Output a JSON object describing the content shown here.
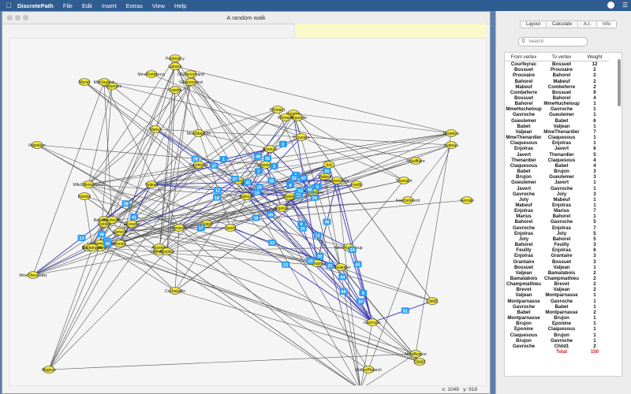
{
  "menubar": {
    "app": "DiscretePath",
    "items": [
      "File",
      "Edit",
      "Insert",
      "Extras",
      "View",
      "Help"
    ]
  },
  "window": {
    "title": "A random walk",
    "coords": {
      "x_label": "x:",
      "x": "1049",
      "y_label": "y:",
      "y": "918"
    }
  },
  "panel": {
    "tabs": [
      "Layout",
      "Calculate",
      "A.I.",
      "Info"
    ],
    "active_tab": "Info",
    "search_placeholder": "Search",
    "columns": [
      "From vertex",
      "To vertex",
      "Weight"
    ],
    "rows": [
      [
        "Courfeyrac",
        "Bossuet",
        "12"
      ],
      [
        "Bossuet",
        "Prouvaire",
        "2"
      ],
      [
        "Prouvaire",
        "Bahorel",
        "2"
      ],
      [
        "Bahorel",
        "Mabeuf",
        "2"
      ],
      [
        "Mabeuf",
        "Combeferre",
        "2"
      ],
      [
        "Combeferre",
        "Bossuet",
        "9"
      ],
      [
        "Bossuet",
        "Bahorel",
        "4"
      ],
      [
        "Bahorel",
        "MmeHucheloup",
        "1"
      ],
      [
        "MmeHucheloup",
        "Gavroche",
        "1"
      ],
      [
        "Gavroche",
        "Gueulemer",
        "1"
      ],
      [
        "Gueulemer",
        "Babet",
        "6"
      ],
      [
        "Babet",
        "Valjean",
        "1"
      ],
      [
        "Valjean",
        "MmeThenardier",
        "7"
      ],
      [
        "MmeThenardier",
        "Claquesous",
        "1"
      ],
      [
        "Claquesous",
        "Enjolras",
        "1"
      ],
      [
        "Enjolras",
        "Javert",
        "6"
      ],
      [
        "Javert",
        "Thenardier",
        "5"
      ],
      [
        "Thenardier",
        "Claquesous",
        "4"
      ],
      [
        "Claquesous",
        "Babet",
        "4"
      ],
      [
        "Babet",
        "Brujon",
        "3"
      ],
      [
        "Brujon",
        "Gueulemer",
        "3"
      ],
      [
        "Gueulemer",
        "Javert",
        "1"
      ],
      [
        "Javert",
        "Gavroche",
        "1"
      ],
      [
        "Gavroche",
        "Joly",
        "3"
      ],
      [
        "Joly",
        "Mabeuf",
        "1"
      ],
      [
        "Mabeuf",
        "Enjolras",
        "1"
      ],
      [
        "Enjolras",
        "Marius",
        "7"
      ],
      [
        "Marius",
        "Bahorel",
        "1"
      ],
      [
        "Bahorel",
        "Gavroche",
        "5"
      ],
      [
        "Gavroche",
        "Enjolras",
        "7"
      ],
      [
        "Enjolras",
        "Joly",
        "5"
      ],
      [
        "Joly",
        "Bahorel",
        "5"
      ],
      [
        "Bahorel",
        "Feuilly",
        "3"
      ],
      [
        "Feuilly",
        "Enjolras",
        "6"
      ],
      [
        "Enjolras",
        "Grantaire",
        "3"
      ],
      [
        "Grantaire",
        "Bossuet",
        "3"
      ],
      [
        "Bossuet",
        "Valjean",
        "1"
      ],
      [
        "Valjean",
        "Bamatabois",
        "2"
      ],
      [
        "Bamatabois",
        "Champmathieu",
        "2"
      ],
      [
        "Champmathieu",
        "Brevet",
        "2"
      ],
      [
        "Brevet",
        "Valjean",
        "2"
      ],
      [
        "Valjean",
        "Montparnasse",
        "1"
      ],
      [
        "Montparnasse",
        "Gavroche",
        "1"
      ],
      [
        "Gavroche",
        "Babet",
        "1"
      ],
      [
        "Babet",
        "Montparnasse",
        "2"
      ],
      [
        "Montparnasse",
        "Brujon",
        "1"
      ],
      [
        "Brujon",
        "Eponine",
        "1"
      ],
      [
        "Eponine",
        "Claquesous",
        "1"
      ],
      [
        "Claquesous",
        "Brujon",
        "1"
      ],
      [
        "Brujon",
        "Gavroche",
        "1"
      ],
      [
        "Gavroche",
        "Child1",
        "2"
      ]
    ],
    "total_label": "Total",
    "total_value": "150"
  },
  "graph": {
    "vertex_color": "#f0e83a",
    "edge_color": "#555555",
    "path_color": "#3a3ab8",
    "badge_color": "#2a9df4",
    "vertices": [
      {
        "id": "Courfeyrac",
        "label": "Courfeyrac"
      },
      {
        "id": "Bossuet",
        "label": "Bossuet"
      },
      {
        "id": "Prouvaire",
        "label": "Prouvaire"
      },
      {
        "id": "Bahorel",
        "label": "Bahorel"
      },
      {
        "id": "Mabeuf",
        "label": "Mabeuf"
      },
      {
        "id": "Combeferre",
        "label": "Combeferre"
      },
      {
        "id": "MmeHucheloup",
        "label": "MmeHucheloup"
      },
      {
        "id": "Gavroche",
        "label": "Gavroche"
      },
      {
        "id": "Gueulemer",
        "label": "Gueulemer"
      },
      {
        "id": "Babet",
        "label": "Babet"
      },
      {
        "id": "Valjean",
        "label": "Valjean"
      },
      {
        "id": "MmeThenardier",
        "label": "MmeThenardier"
      },
      {
        "id": "Claquesous",
        "label": "Claquesous"
      },
      {
        "id": "Enjolras",
        "label": "Enjolras"
      },
      {
        "id": "Javert",
        "label": "Javert"
      },
      {
        "id": "Thenardier",
        "label": "Thenardier"
      },
      {
        "id": "Brujon",
        "label": "Brujon"
      },
      {
        "id": "Joly",
        "label": "Joly"
      },
      {
        "id": "Marius",
        "label": "Marius"
      },
      {
        "id": "Feuilly",
        "label": "Feuilly"
      },
      {
        "id": "Grantaire",
        "label": "Grantaire"
      },
      {
        "id": "Bamatabois",
        "label": "Bamatabois"
      },
      {
        "id": "Champmathieu",
        "label": "Champmathieu"
      },
      {
        "id": "Brevet",
        "label": "Brevet"
      },
      {
        "id": "Montparnasse",
        "label": "Montparnasse"
      },
      {
        "id": "Eponine",
        "label": "Eponine"
      },
      {
        "id": "Child1",
        "label": "Child1"
      },
      {
        "id": "Child2",
        "label": "Child2"
      },
      {
        "id": "Mother",
        "label": "MotherPlutarch"
      },
      {
        "id": "Jondrette",
        "label": "Jondrette"
      },
      {
        "id": "Magnon",
        "label": "Magnon"
      },
      {
        "id": "Napoleon",
        "label": "Napoleon"
      },
      {
        "id": "MlleGillenormand",
        "label": "MlleGillenormand"
      },
      {
        "id": "Fantine",
        "label": "Fantine"
      },
      {
        "id": "Myriel",
        "label": "Myriel"
      },
      {
        "id": "Cosette",
        "label": "Cosette"
      },
      {
        "id": "Gillenormand",
        "label": "Gillenormand"
      },
      {
        "id": "Pontmercy",
        "label": "Pontmercy"
      },
      {
        "id": "Labarre",
        "label": "Labarre"
      },
      {
        "id": "Marguerite",
        "label": "Marguerite"
      },
      {
        "id": "Toussaint",
        "label": "Toussaint"
      },
      {
        "id": "Scaufflaire",
        "label": "Scaufflaire"
      },
      {
        "id": "Fauchelevent",
        "label": "Fauchelevent"
      },
      {
        "id": "Perpetue",
        "label": "Perpetue"
      },
      {
        "id": "Isabeau",
        "label": "Isabeau"
      },
      {
        "id": "Gervais",
        "label": "Gervais"
      },
      {
        "id": "Tholomyes",
        "label": "Tholomyes"
      },
      {
        "id": "Listolier",
        "label": "Listolier"
      },
      {
        "id": "Fameuil",
        "label": "Fameuil"
      },
      {
        "id": "Blacheville",
        "label": "Blacheville"
      },
      {
        "id": "Favourite",
        "label": "Favourite"
      },
      {
        "id": "Dahlia",
        "label": "Dahlia"
      },
      {
        "id": "Zephine",
        "label": "Zephine"
      },
      {
        "id": "MmePontmercy",
        "label": "MmePontmercy"
      },
      {
        "id": "MlleVaubois",
        "label": "MlleVaubois"
      },
      {
        "id": "LtGillenormand",
        "label": "LtGillenormand"
      },
      {
        "id": "MmeMagloire",
        "label": "MmeMagloire"
      },
      {
        "id": "MmeBurgon",
        "label": "MmeBurgon"
      },
      {
        "id": "Cochepaille",
        "label": "Cochepaille"
      },
      {
        "id": "Chenildieu",
        "label": "Chenildieu"
      },
      {
        "id": "Judge",
        "label": "Judge"
      },
      {
        "id": "Woman1",
        "label": "Woman1"
      },
      {
        "id": "Woman2",
        "label": "Woman2"
      },
      {
        "id": "Boulatruelle",
        "label": "Boulatruelle"
      },
      {
        "id": "Anzelma",
        "label": "Anzelma"
      },
      {
        "id": "Simplice",
        "label": "Simplice"
      }
    ],
    "path_edges": [
      [
        "Courfeyrac",
        "Bossuet",
        "1"
      ],
      [
        "Bossuet",
        "Prouvaire",
        "2"
      ],
      [
        "Prouvaire",
        "Bahorel",
        "3"
      ],
      [
        "Bahorel",
        "Mabeuf",
        "4"
      ],
      [
        "Mabeuf",
        "Combeferre",
        "5"
      ],
      [
        "Combeferre",
        "Bossuet",
        "6"
      ],
      [
        "Bossuet",
        "Bahorel",
        "7"
      ],
      [
        "Bahorel",
        "MmeHucheloup",
        "8"
      ],
      [
        "MmeHucheloup",
        "Gavroche",
        "9"
      ],
      [
        "Gavroche",
        "Gueulemer",
        "10"
      ],
      [
        "Gueulemer",
        "Babet",
        "11"
      ],
      [
        "Babet",
        "Valjean",
        "12"
      ],
      [
        "Valjean",
        "MmeThenardier",
        "13"
      ],
      [
        "MmeThenardier",
        "Claquesous",
        "14"
      ],
      [
        "Claquesous",
        "Enjolras",
        "15"
      ],
      [
        "Enjolras",
        "Javert",
        "16"
      ],
      [
        "Javert",
        "Thenardier",
        "17"
      ],
      [
        "Thenardier",
        "Claquesous",
        "18"
      ],
      [
        "Claquesous",
        "Babet",
        "19"
      ],
      [
        "Babet",
        "Brujon",
        "20"
      ],
      [
        "Brujon",
        "Gueulemer",
        "21"
      ],
      [
        "Gueulemer",
        "Javert",
        "22"
      ],
      [
        "Javert",
        "Gavroche",
        "23"
      ],
      [
        "Gavroche",
        "Joly",
        "24"
      ],
      [
        "Joly",
        "Mabeuf",
        "25"
      ],
      [
        "Mabeuf",
        "Enjolras",
        "26"
      ],
      [
        "Enjolras",
        "Marius",
        "27"
      ],
      [
        "Marius",
        "Bahorel",
        "28"
      ],
      [
        "Bahorel",
        "Gavroche",
        "29"
      ],
      [
        "Gavroche",
        "Enjolras",
        "30"
      ],
      [
        "Enjolras",
        "Joly",
        "31"
      ],
      [
        "Joly",
        "Bahorel",
        "32"
      ],
      [
        "Bahorel",
        "Feuilly",
        "33"
      ],
      [
        "Feuilly",
        "Enjolras",
        "34"
      ],
      [
        "Enjolras",
        "Grantaire",
        "35"
      ],
      [
        "Grantaire",
        "Bossuet",
        "36"
      ],
      [
        "Bossuet",
        "Valjean",
        "37"
      ],
      [
        "Valjean",
        "Bamatabois",
        "38"
      ],
      [
        "Bamatabois",
        "Champmathieu",
        "39"
      ],
      [
        "Champmathieu",
        "Brevet",
        "40"
      ],
      [
        "Brevet",
        "Valjean",
        "41"
      ],
      [
        "Valjean",
        "Montparnasse",
        "42"
      ],
      [
        "Montparnasse",
        "Gavroche",
        "43"
      ],
      [
        "Gavroche",
        "Babet",
        "44"
      ],
      [
        "Babet",
        "Montparnasse",
        "45"
      ],
      [
        "Montparnasse",
        "Brujon",
        "46"
      ],
      [
        "Brujon",
        "Eponine",
        "47"
      ],
      [
        "Eponine",
        "Claquesous",
        "48"
      ],
      [
        "Claquesous",
        "Brujon",
        "49"
      ],
      [
        "Brujon",
        "Gavroche",
        "50"
      ],
      [
        "Gavroche",
        "Child1",
        "51"
      ]
    ]
  }
}
